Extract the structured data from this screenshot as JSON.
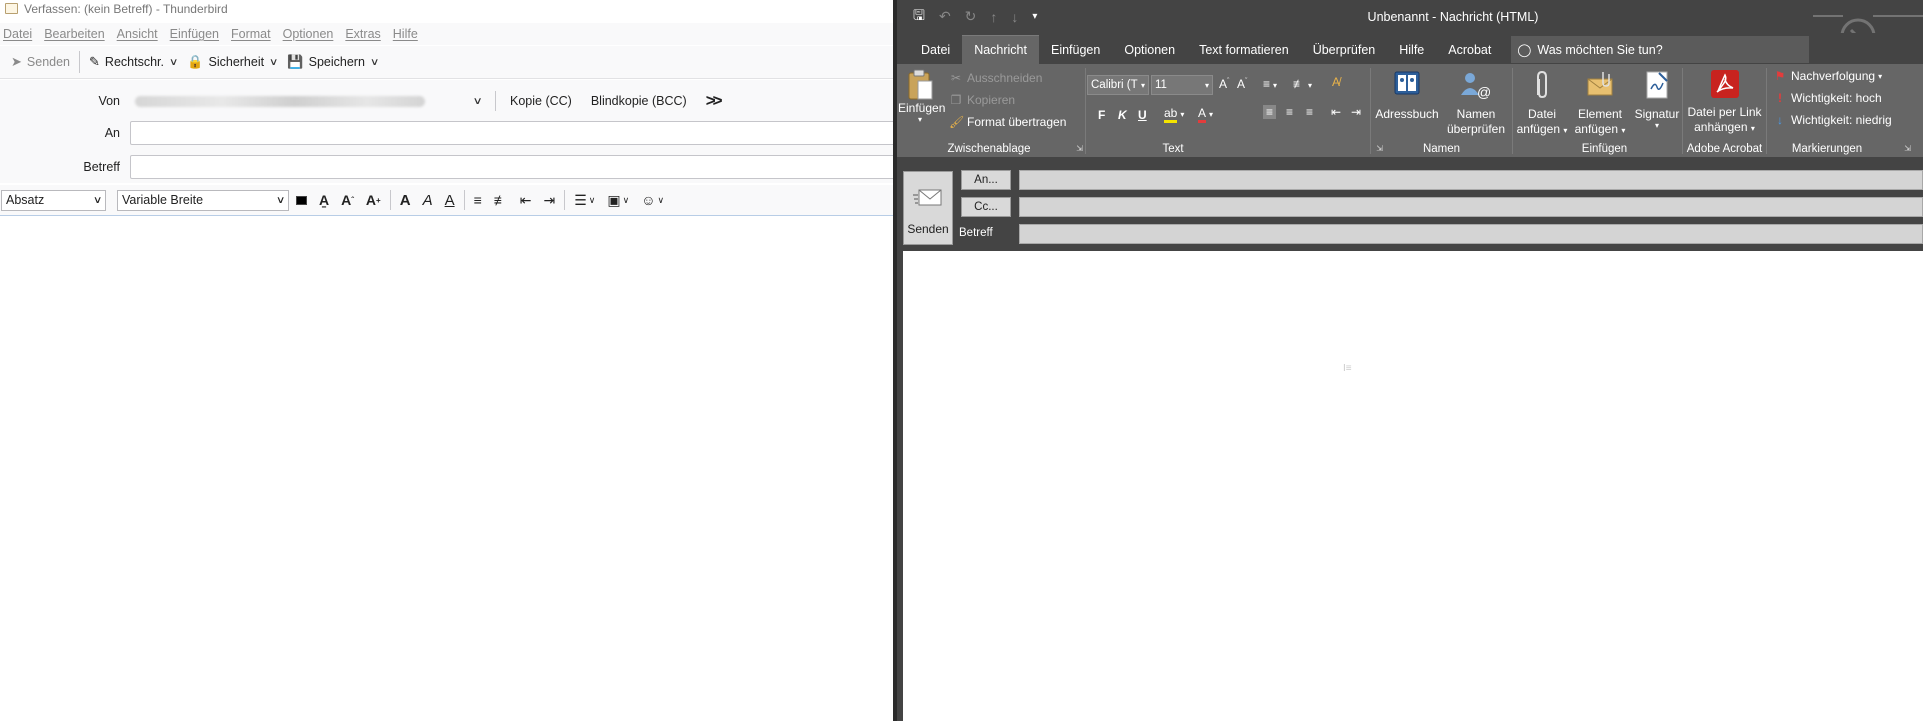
{
  "thunderbird": {
    "title": "Verfassen: (kein Betreff) - Thunderbird",
    "menu": [
      "Datei",
      "Bearbeiten",
      "Ansicht",
      "Einfügen",
      "Format",
      "Optionen",
      "Extras",
      "Hilfe"
    ],
    "toolbar": {
      "send": "Senden",
      "spelling": "Rechtschr.",
      "security": "Sicherheit",
      "save": "Speichern"
    },
    "header": {
      "from_label": "Von",
      "cc_label": "Kopie (CC)",
      "bcc_label": "Blindkopie (BCC)",
      "to_label": "An",
      "to_value": "",
      "subject_label": "Betreff",
      "subject_value": ""
    },
    "format": {
      "paragraph": "Absatz",
      "font": "Variable Breite"
    }
  },
  "outlook": {
    "title": "Unbenannt  -  Nachricht (HTML)",
    "tabs": [
      "Datei",
      "Nachricht",
      "Einfügen",
      "Optionen",
      "Text formatieren",
      "Überprüfen",
      "Hilfe",
      "Acrobat"
    ],
    "active_tab": "Nachricht",
    "search_placeholder": "Was möchten Sie tun?",
    "ribbon": {
      "clipboard": {
        "label": "Zwischenablage",
        "paste": "Einfügen",
        "cut": "Ausschneiden",
        "copy": "Kopieren",
        "format_painter": "Format übertragen"
      },
      "text": {
        "label": "Text",
        "font": "Calibri (T",
        "size": "11",
        "bold": "F",
        "italic": "K",
        "underline": "U"
      },
      "names": {
        "label": "Namen",
        "addressbook": "Adressbuch",
        "check_names_1": "Namen",
        "check_names_2": "überprüfen"
      },
      "insert": {
        "label": "Einfügen",
        "attach_1": "Datei",
        "attach_2": "anfügen",
        "item_1": "Element",
        "item_2": "anfügen",
        "signature": "Signatur"
      },
      "acrobat": {
        "label": "Adobe Acrobat",
        "link_1": "Datei per Link",
        "link_2": "anhängen"
      },
      "tags": {
        "label": "Markierungen",
        "followup": "Nachverfolgung",
        "high": "Wichtigkeit: hoch",
        "low": "Wichtigkeit: niedrig"
      }
    },
    "header": {
      "send": "Senden",
      "to_btn": "An...",
      "cc_btn": "Cc...",
      "subject_label": "Betreff"
    },
    "colors": {
      "ribbon_bg": "#666666",
      "titlebar_bg": "#444444",
      "acrobat_red": "#c8231f",
      "flag_red": "#e33c3c",
      "importance_low": "#4a9ae8"
    }
  }
}
